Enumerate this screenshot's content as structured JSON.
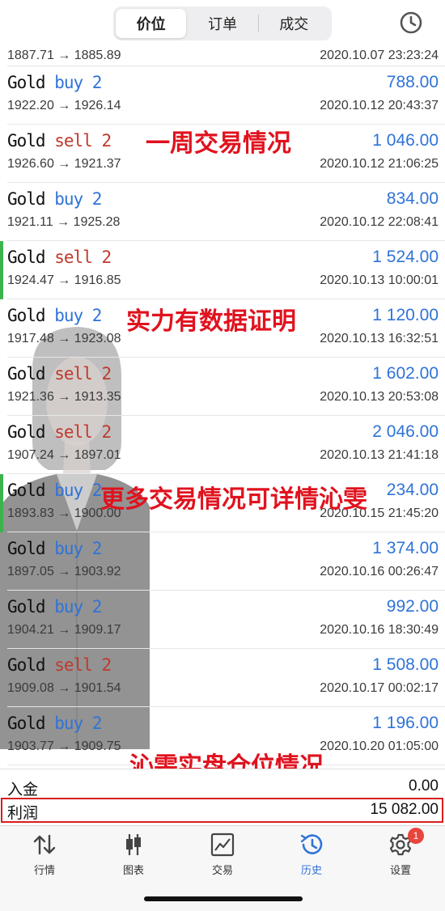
{
  "header": {
    "tabs": [
      "价位",
      "订单",
      "成交"
    ],
    "active_tab": "价位"
  },
  "first_row": {
    "prices": "1887.71 → 1885.89",
    "time": "2020.10.07 23:23:24"
  },
  "trades": [
    {
      "symbol": "Gold",
      "side": "buy 2",
      "type": "buy",
      "profit": "788.00",
      "prices": "1922.20 → 1926.14",
      "time": "2020.10.12 20:43:37",
      "marked": false
    },
    {
      "symbol": "Gold",
      "side": "sell 2",
      "type": "sell",
      "profit": "1 046.00",
      "prices": "1926.60 → 1921.37",
      "time": "2020.10.12 21:06:25",
      "marked": false
    },
    {
      "symbol": "Gold",
      "side": "buy 2",
      "type": "buy",
      "profit": "834.00",
      "prices": "1921.11 → 1925.28",
      "time": "2020.10.12 22:08:41",
      "marked": false
    },
    {
      "symbol": "Gold",
      "side": "sell 2",
      "type": "sell",
      "profit": "1 524.00",
      "prices": "1924.47 → 1916.85",
      "time": "2020.10.13 10:00:01",
      "marked": true
    },
    {
      "symbol": "Gold",
      "side": "buy 2",
      "type": "buy",
      "profit": "1 120.00",
      "prices": "1917.48 → 1923.08",
      "time": "2020.10.13 16:32:51",
      "marked": false
    },
    {
      "symbol": "Gold",
      "side": "sell 2",
      "type": "sell",
      "profit": "1 602.00",
      "prices": "1921.36 → 1913.35",
      "time": "2020.10.13 20:53:08",
      "marked": false
    },
    {
      "symbol": "Gold",
      "side": "sell 2",
      "type": "sell",
      "profit": "2 046.00",
      "prices": "1907.24 → 1897.01",
      "time": "2020.10.13 21:41:18",
      "marked": false
    },
    {
      "symbol": "Gold",
      "side": "buy 2",
      "type": "buy",
      "profit": "234.00",
      "prices": "1893.83 → 1900.00",
      "time": "2020.10.15 21:45:20",
      "marked": true
    },
    {
      "symbol": "Gold",
      "side": "buy 2",
      "type": "buy",
      "profit": "1 374.00",
      "prices": "1897.05 → 1903.92",
      "time": "2020.10.16 00:26:47",
      "marked": false
    },
    {
      "symbol": "Gold",
      "side": "buy 2",
      "type": "buy",
      "profit": "992.00",
      "prices": "1904.21 → 1909.17",
      "time": "2020.10.16 18:30:49",
      "marked": false
    },
    {
      "symbol": "Gold",
      "side": "sell 2",
      "type": "sell",
      "profit": "1 508.00",
      "prices": "1909.08 → 1901.54",
      "time": "2020.10.17 00:02:17",
      "marked": false
    },
    {
      "symbol": "Gold",
      "side": "buy 2",
      "type": "buy",
      "profit": "1 196.00",
      "prices": "1903.77 → 1909.75",
      "time": "2020.10.20 01:05:00",
      "marked": false
    }
  ],
  "overlays": {
    "text1": "一周交易情况",
    "text2": "实力有数据证明",
    "text3": "更多交易情况可详情沁雯",
    "text4": "沁雯实盘仓位情况"
  },
  "summary": {
    "deposit_label": "入金",
    "deposit_value": "0.00",
    "profit_label": "利润",
    "profit_value": "15 082.00"
  },
  "tabbar": {
    "items": [
      {
        "label": "行情",
        "icon": "arrows-updown-icon"
      },
      {
        "label": "图表",
        "icon": "candlestick-icon"
      },
      {
        "label": "交易",
        "icon": "chart-trend-icon"
      },
      {
        "label": "历史",
        "icon": "history-clock-icon"
      },
      {
        "label": "设置",
        "icon": "gear-icon"
      }
    ],
    "active": "历史",
    "settings_badge": "1"
  },
  "colors": {
    "buy": "#2f73d8",
    "sell": "#c0392b",
    "accent": "#2f73d8",
    "annotation": "#e0121e",
    "marker": "#3cb44b"
  }
}
